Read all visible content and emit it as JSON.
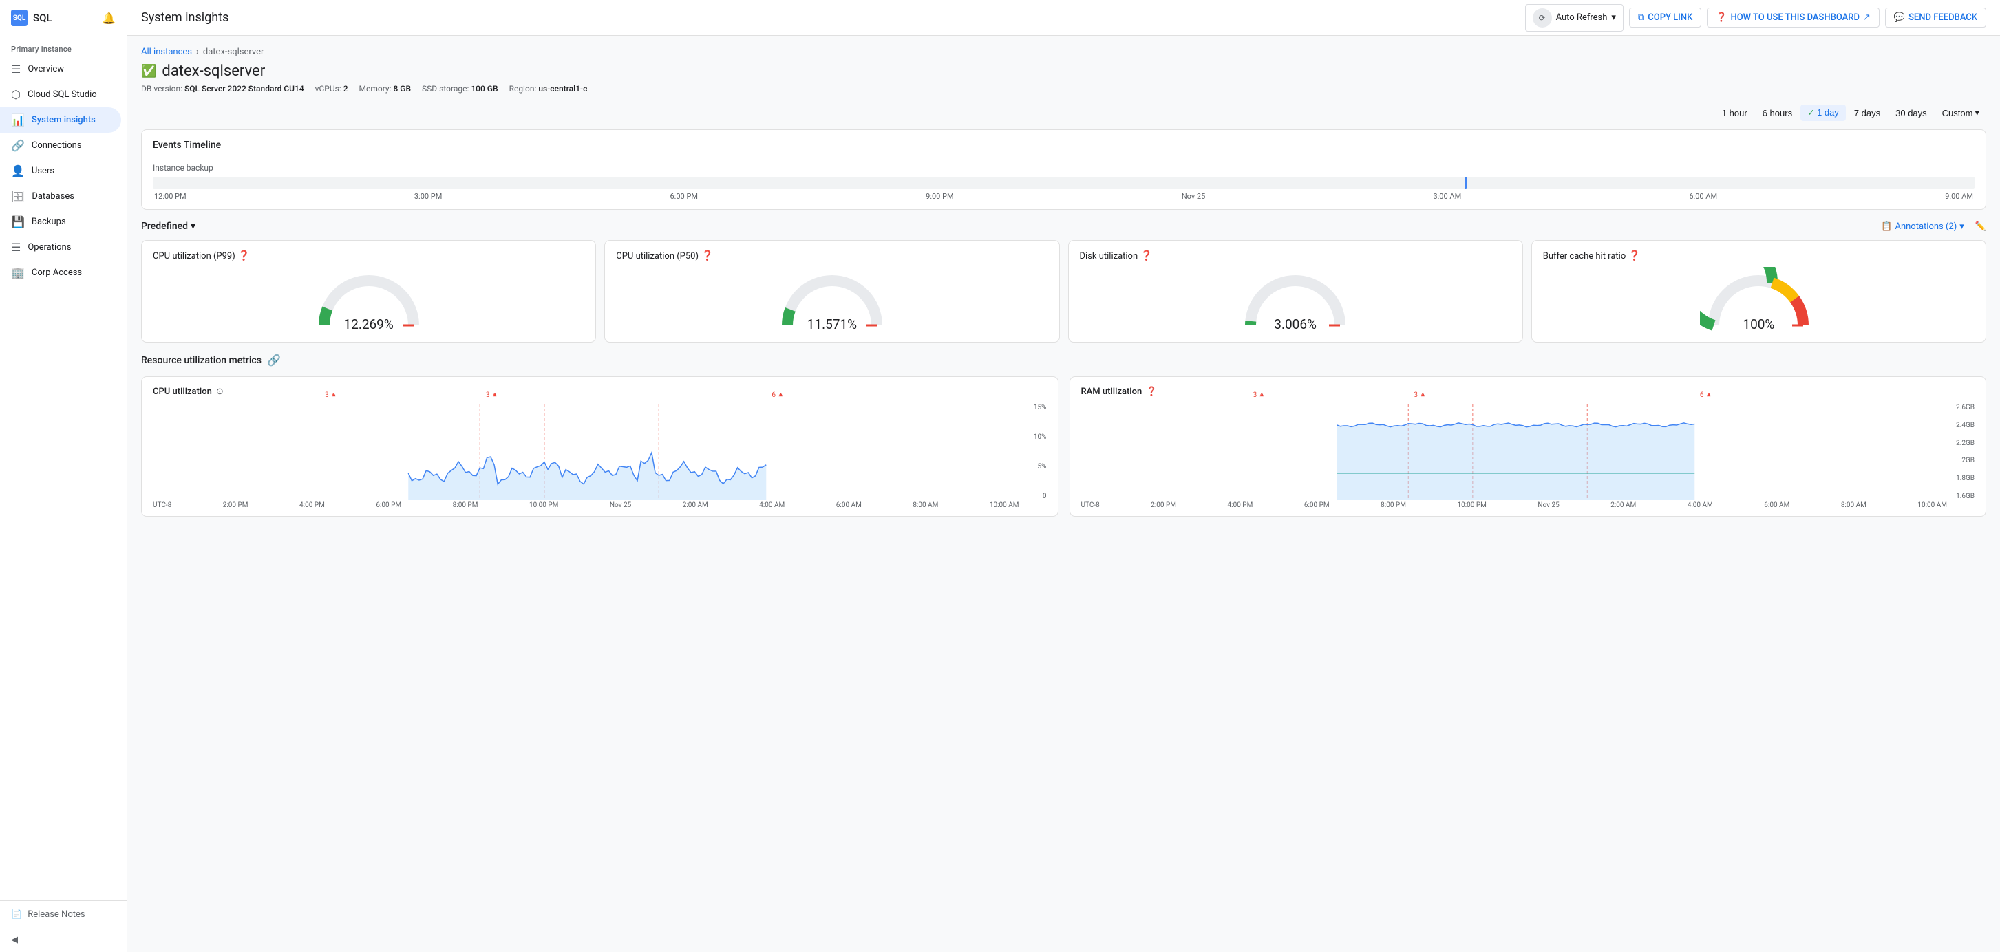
{
  "app": {
    "logo": "SQL",
    "title": "SQL"
  },
  "topbar": {
    "title": "System insights",
    "auto_refresh_label": "Auto Refresh",
    "copy_link_label": "COPY LINK",
    "how_to_label": "HOW TO USE THIS DASHBOARD",
    "send_feedback_label": "SEND FEEDBACK"
  },
  "sidebar": {
    "section_label": "Primary instance",
    "items": [
      {
        "id": "overview",
        "label": "Overview",
        "icon": "☰",
        "active": false
      },
      {
        "id": "cloud-sql-studio",
        "label": "Cloud SQL Studio",
        "icon": "⬡",
        "active": false
      },
      {
        "id": "system-insights",
        "label": "System insights",
        "icon": "📊",
        "active": true
      },
      {
        "id": "connections",
        "label": "Connections",
        "icon": "🔗",
        "active": false
      },
      {
        "id": "users",
        "label": "Users",
        "icon": "👤",
        "active": false
      },
      {
        "id": "databases",
        "label": "Databases",
        "icon": "🗄",
        "active": false
      },
      {
        "id": "backups",
        "label": "Backups",
        "icon": "💾",
        "active": false
      },
      {
        "id": "operations",
        "label": "Operations",
        "icon": "☰",
        "active": false
      },
      {
        "id": "corp-access",
        "label": "Corp Access",
        "icon": "🏢",
        "active": false
      }
    ],
    "footer": {
      "release_notes": "Release Notes"
    }
  },
  "breadcrumb": {
    "all_instances": "All instances",
    "separator": "›",
    "current": "datex-sqlserver"
  },
  "instance": {
    "name": "datex-sqlserver",
    "status": "healthy",
    "db_version_label": "DB version:",
    "db_version": "SQL Server 2022 Standard CU14",
    "vcpus_label": "vCPUs:",
    "vcpus": "2",
    "memory_label": "Memory:",
    "memory": "8 GB",
    "ssd_label": "SSD storage:",
    "ssd": "100 GB",
    "region_label": "Region:",
    "region": "us-central1-c"
  },
  "time_range": {
    "options": [
      "1 hour",
      "6 hours",
      "1 day",
      "7 days",
      "30 days",
      "Custom"
    ],
    "active": "1 day"
  },
  "events_timeline": {
    "title": "Events Timeline",
    "track_label": "Instance backup",
    "x_axis": [
      "12:00 PM",
      "3:00 PM",
      "6:00 PM",
      "9:00 PM",
      "Nov 25",
      "3:00 AM",
      "6:00 AM",
      "9:00 AM"
    ],
    "dot_position_pct": 72
  },
  "predefined": {
    "section_label": "Predefined",
    "annotations_label": "Annotations (2)",
    "gauges": [
      {
        "id": "cpu-p99",
        "title": "CPU utilization (P99)",
        "value": "12.269%",
        "pct": 12.269,
        "color_main": "#34a853",
        "color_warn": "#fbbc04",
        "color_danger": "#ea4335"
      },
      {
        "id": "cpu-p50",
        "title": "CPU utilization (P50)",
        "value": "11.571%",
        "pct": 11.571,
        "color_main": "#34a853",
        "color_warn": "#fbbc04",
        "color_danger": "#ea4335"
      },
      {
        "id": "disk",
        "title": "Disk utilization",
        "value": "3.006%",
        "pct": 3.006,
        "color_main": "#34a853",
        "color_warn": "#fbbc04",
        "color_danger": "#ea4335"
      },
      {
        "id": "buffer-cache",
        "title": "Buffer cache hit ratio",
        "value": "100%",
        "pct": 100,
        "color_main": "#34a853",
        "color_warn": "#fbbc04",
        "color_danger": "#ea4335"
      }
    ]
  },
  "resource_metrics": {
    "title": "Resource utilization metrics",
    "charts": [
      {
        "id": "cpu-utilization",
        "title": "CPU utilization",
        "y_labels": [
          "15%",
          "10%",
          "5%",
          "0"
        ],
        "x_labels": [
          "UTC-8",
          "2:00 PM",
          "4:00 PM",
          "6:00 PM",
          "8:00 PM",
          "10:00 PM",
          "Nov 25",
          "2:00 AM",
          "4:00 AM",
          "6:00 AM",
          "8:00 AM",
          "10:00 AM"
        ],
        "alert_markers": [
          {
            "value": "3",
            "pos_pct": 20
          },
          {
            "value": "3",
            "pos_pct": 38
          },
          {
            "value": "6",
            "pos_pct": 70
          }
        ],
        "fill_color": "#bbdefb",
        "line_color": "#4285f4"
      },
      {
        "id": "ram-utilization",
        "title": "RAM utilization",
        "y_labels": [
          "2.6GB",
          "2.4GB",
          "2.2GB",
          "2GB",
          "1.8GB",
          "1.6GB"
        ],
        "x_labels": [
          "UTC-8",
          "2:00 PM",
          "4:00 PM",
          "6:00 PM",
          "8:00 PM",
          "10:00 PM",
          "Nov 25",
          "2:00 AM",
          "4:00 AM",
          "6:00 AM",
          "8:00 AM",
          "10:00 AM"
        ],
        "alert_markers": [
          {
            "value": "3",
            "pos_pct": 20
          },
          {
            "value": "3",
            "pos_pct": 38
          },
          {
            "value": "6",
            "pos_pct": 70
          }
        ],
        "fill_color": "#bbdefb",
        "line_color": "#4285f4"
      }
    ]
  }
}
